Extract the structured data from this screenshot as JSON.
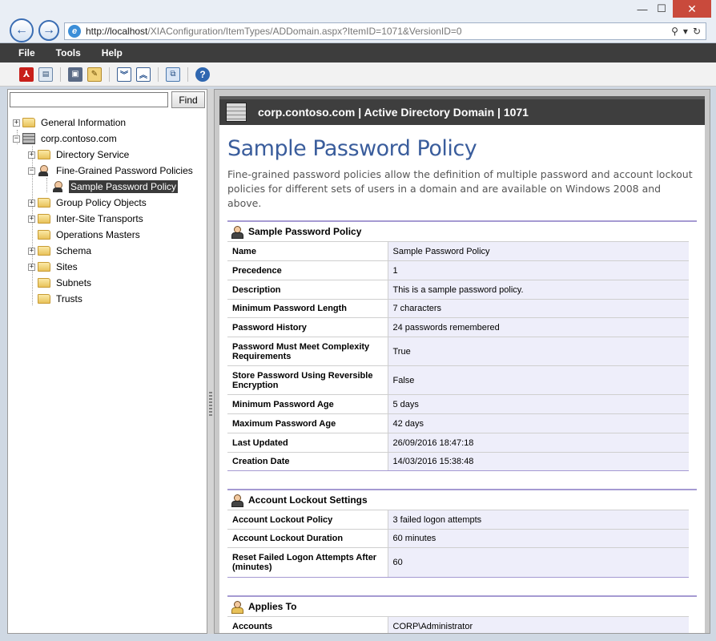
{
  "browser": {
    "url_host": "http://localhost",
    "url_path": "/XIAConfiguration/ItemTypes/ADDomain.aspx?ItemID=1071&VersionID=0",
    "window_buttons": {
      "minimize": "—",
      "maximize": "☐",
      "close": "✕"
    }
  },
  "menu": {
    "file": "File",
    "tools": "Tools",
    "help": "Help"
  },
  "search": {
    "value": "",
    "find_label": "Find"
  },
  "tree": {
    "general_information": "General Information",
    "domain": "corp.contoso.com",
    "directory_service": "Directory Service",
    "fine_grained": "Fine-Grained Password Policies",
    "sample_policy": "Sample Password Policy",
    "group_policy_objects": "Group Policy Objects",
    "inter_site_transports": "Inter-Site Transports",
    "operations_masters": "Operations Masters",
    "schema": "Schema",
    "sites": "Sites",
    "subnets": "Subnets",
    "trusts": "Trusts"
  },
  "content": {
    "header": "corp.contoso.com | Active Directory Domain | 1071",
    "title": "Sample Password Policy",
    "intro": "Fine-grained password policies allow the definition of multiple password and account lockout policies for different sets of users in a domain and are available on Windows 2008 and above.",
    "policy_section": {
      "title": "Sample Password Policy",
      "rows": [
        {
          "k": "Name",
          "v": "Sample Password Policy"
        },
        {
          "k": "Precedence",
          "v": "1"
        },
        {
          "k": "Description",
          "v": "This is a sample password policy."
        },
        {
          "k": "Minimum Password Length",
          "v": "7 characters"
        },
        {
          "k": "Password History",
          "v": "24 passwords remembered"
        },
        {
          "k": "Password Must Meet Complexity Requirements",
          "v": "True"
        },
        {
          "k": "Store Password Using Reversible Encryption",
          "v": "False"
        },
        {
          "k": "Minimum Password Age",
          "v": "5 days"
        },
        {
          "k": "Maximum Password Age",
          "v": "42 days"
        },
        {
          "k": "Last Updated",
          "v": "26/09/2016 18:47:18"
        },
        {
          "k": "Creation Date",
          "v": "14/03/2016 15:38:48"
        }
      ]
    },
    "lockout_section": {
      "title": "Account Lockout Settings",
      "rows": [
        {
          "k": "Account Lockout Policy",
          "v": "3 failed logon attempts"
        },
        {
          "k": "Account Lockout Duration",
          "v": "60 minutes"
        },
        {
          "k": "Reset Failed Logon Attempts After (minutes)",
          "v": "60"
        }
      ]
    },
    "applies_section": {
      "title": "Applies To",
      "rows": [
        {
          "k": "Accounts",
          "v": "CORP\\Administrator"
        }
      ]
    }
  }
}
